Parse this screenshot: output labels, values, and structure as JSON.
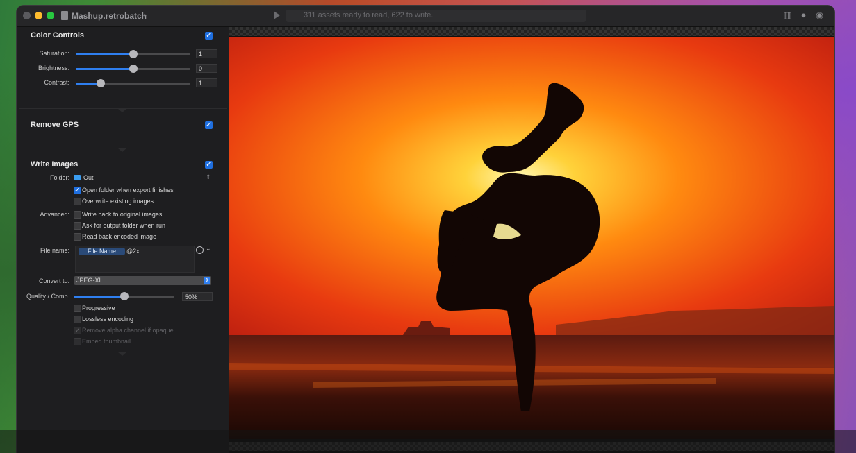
{
  "window": {
    "title": "Mashup.retrobatch",
    "status": "311 assets ready to read, 622 to write."
  },
  "icons": {
    "close": "traffic-light-close",
    "minimize": "traffic-light-minimize",
    "zoom": "traffic-light-zoom",
    "document": "document-icon",
    "chevron": "chevron-down-icon",
    "play": "play-icon",
    "book": "book-icon",
    "comment": "speech-bubble-icon",
    "user": "user-circle-icon"
  },
  "colors": {
    "close": "#ff5f57",
    "minimize": "#febc2e",
    "zoom": "#28c840",
    "accent": "#1f6fe0"
  },
  "color_controls": {
    "title": "Color Controls",
    "enabled": true,
    "saturation": {
      "label": "Saturation:",
      "value": "1",
      "level": 0.5
    },
    "brightness": {
      "label": "Brightness:",
      "value": "0",
      "level": 0.5
    },
    "contrast": {
      "label": "Contrast:",
      "value": "1",
      "level": 0.22
    }
  },
  "remove_gps": {
    "title": "Remove GPS",
    "enabled": true
  },
  "write_images": {
    "title": "Write Images",
    "enabled": true,
    "folder_label": "Folder:",
    "folder_value": "Out",
    "options": [
      {
        "label": "Open folder when export finishes",
        "checked": true
      },
      {
        "label": "Overwrite existing images",
        "checked": false
      }
    ],
    "advanced_label": "Advanced:",
    "advanced_options": [
      {
        "label": "Write back to original images",
        "checked": false
      },
      {
        "label": "Ask for output folder when run",
        "checked": false
      },
      {
        "label": "Read back encoded image",
        "checked": false
      }
    ],
    "file_name_label": "File name:",
    "file_name_token": "File Name",
    "file_name_suffix": "@2x",
    "convert_label": "Convert to:",
    "convert_value": "JPEG-XL",
    "quality_label": "Quality / Comp.",
    "quality_value": "50%",
    "quality_level": 0.5,
    "format_options": [
      {
        "label": "Progressive",
        "checked": false,
        "disabled": false
      },
      {
        "label": "Lossless encoding",
        "checked": false,
        "disabled": false
      },
      {
        "label": "Remove alpha channel if opaque",
        "checked": true,
        "disabled": true
      },
      {
        "label": "Embed thumbnail",
        "checked": false,
        "disabled": true
      }
    ]
  }
}
